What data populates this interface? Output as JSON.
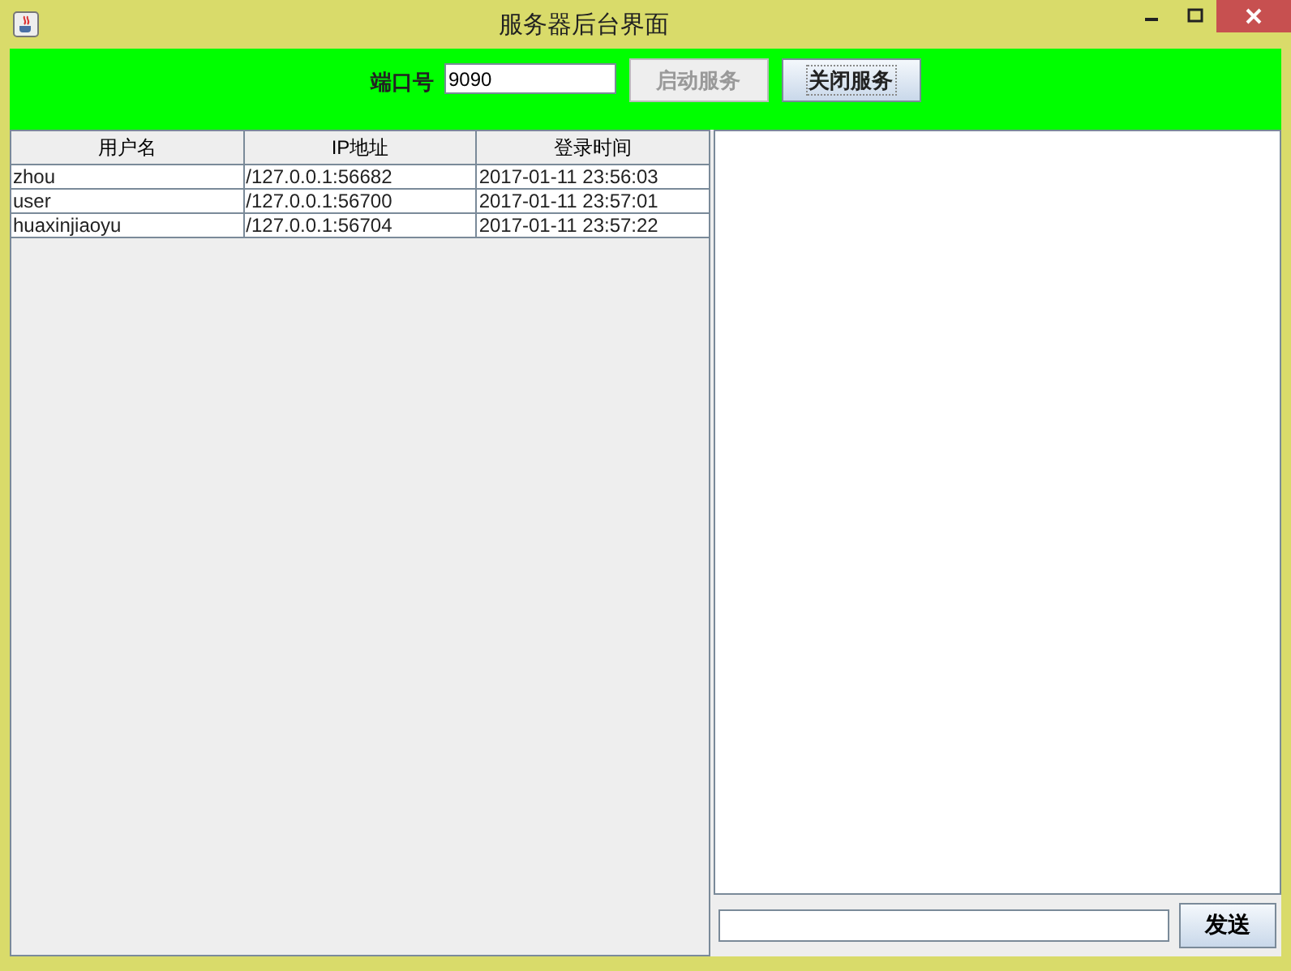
{
  "window": {
    "title": "服务器后台界面"
  },
  "toolbar": {
    "port_label": "端口号",
    "port_value": "9090",
    "buttons": [
      {
        "label": "启动服务",
        "disabled": true,
        "focused": false
      },
      {
        "label": "关闭服务",
        "disabled": false,
        "focused": true
      }
    ]
  },
  "table": {
    "columns": [
      "用户名",
      "IP地址",
      "登录时间"
    ],
    "rows": [
      [
        "zhou",
        "/127.0.0.1:56682",
        "2017-01-11 23:56:03"
      ],
      [
        "user",
        "/127.0.0.1:56700",
        "2017-01-11 23:57:01"
      ],
      [
        "huaxinjiaoyu",
        "/127.0.0.1:56704",
        "2017-01-11 23:57:22"
      ]
    ]
  },
  "chat": {
    "send_button": "发送"
  }
}
